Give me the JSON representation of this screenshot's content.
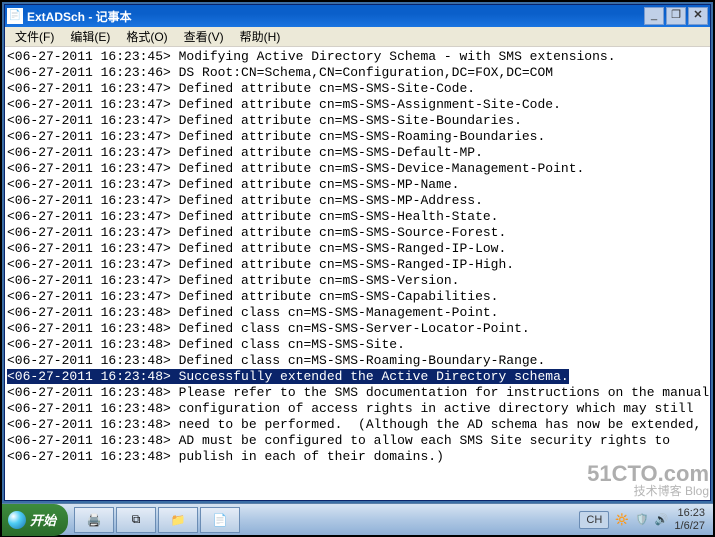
{
  "window": {
    "title": "ExtADSch - 记事本",
    "icon_label": "📄"
  },
  "menus": {
    "file": "文件(F)",
    "edit": "编辑(E)",
    "format": "格式(O)",
    "view": "查看(V)",
    "help": "帮助(H)"
  },
  "log": {
    "lines": [
      "<06-27-2011 16:23:45> Modifying Active Directory Schema - with SMS extensions.",
      "<06-27-2011 16:23:46> DS Root:CN=Schema,CN=Configuration,DC=FOX,DC=COM",
      "<06-27-2011 16:23:47> Defined attribute cn=MS-SMS-Site-Code.",
      "<06-27-2011 16:23:47> Defined attribute cn=mS-SMS-Assignment-Site-Code.",
      "<06-27-2011 16:23:47> Defined attribute cn=MS-SMS-Site-Boundaries.",
      "<06-27-2011 16:23:47> Defined attribute cn=MS-SMS-Roaming-Boundaries.",
      "<06-27-2011 16:23:47> Defined attribute cn=MS-SMS-Default-MP.",
      "<06-27-2011 16:23:47> Defined attribute cn=mS-SMS-Device-Management-Point.",
      "<06-27-2011 16:23:47> Defined attribute cn=MS-SMS-MP-Name.",
      "<06-27-2011 16:23:47> Defined attribute cn=MS-SMS-MP-Address.",
      "<06-27-2011 16:23:47> Defined attribute cn=mS-SMS-Health-State.",
      "<06-27-2011 16:23:47> Defined attribute cn=mS-SMS-Source-Forest.",
      "<06-27-2011 16:23:47> Defined attribute cn=MS-SMS-Ranged-IP-Low.",
      "<06-27-2011 16:23:47> Defined attribute cn=MS-SMS-Ranged-IP-High.",
      "<06-27-2011 16:23:47> Defined attribute cn=mS-SMS-Version.",
      "<06-27-2011 16:23:47> Defined attribute cn=mS-SMS-Capabilities.",
      "<06-27-2011 16:23:48> Defined class cn=MS-SMS-Management-Point.",
      "<06-27-2011 16:23:48> Defined class cn=MS-SMS-Server-Locator-Point.",
      "<06-27-2011 16:23:48> Defined class cn=MS-SMS-Site.",
      "<06-27-2011 16:23:48> Defined class cn=MS-SMS-Roaming-Boundary-Range."
    ],
    "highlighted_line": "<06-27-2011 16:23:48> Successfully extended the Active Directory schema.",
    "lines_after": [
      "",
      "<06-27-2011 16:23:48> Please refer to the SMS documentation for instructions on the manual",
      "<06-27-2011 16:23:48> configuration of access rights in active directory which may still",
      "<06-27-2011 16:23:48> need to be performed.  (Although the AD schema has now be extended,",
      "<06-27-2011 16:23:48> AD must be configured to allow each SMS Site security rights to",
      "<06-27-2011 16:23:48> publish in each of their domains.)"
    ]
  },
  "taskbar": {
    "start": "开始",
    "items": [
      "print",
      "shell",
      "explorer",
      "notepad"
    ],
    "tray": {
      "lang": "CH",
      "time": "16:23",
      "date": "1/6/27"
    }
  },
  "watermark": {
    "main": "51CTO.com",
    "sub": "技术博客 Blog"
  }
}
